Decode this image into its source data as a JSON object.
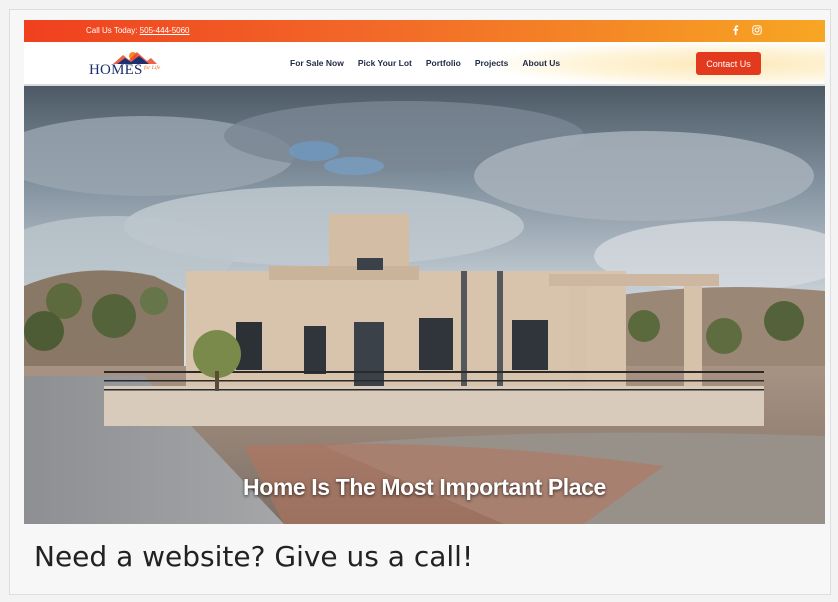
{
  "topbar": {
    "call_label": "Call Us Today:",
    "phone": "505-444-5060",
    "social": [
      {
        "icon": "facebook-icon",
        "glyph": "f"
      },
      {
        "icon": "instagram-icon",
        "glyph": "◎"
      }
    ]
  },
  "nav": {
    "logo_text": "HOMES",
    "logo_sub": "for Life",
    "items": [
      {
        "label": "For Sale Now"
      },
      {
        "label": "Pick Your Lot"
      },
      {
        "label": "Portfolio"
      },
      {
        "label": "Projects"
      },
      {
        "label": "About Us"
      }
    ],
    "cta_label": "Contact Us"
  },
  "hero": {
    "tagline": "Home Is The Most Important Place"
  },
  "footer_message": "Need a website? Give us a call!",
  "colors": {
    "topbar_start": "#f0401f",
    "topbar_end": "#f7a623",
    "cta": "#e33a1e",
    "logo_blue": "#1d2f6e"
  }
}
